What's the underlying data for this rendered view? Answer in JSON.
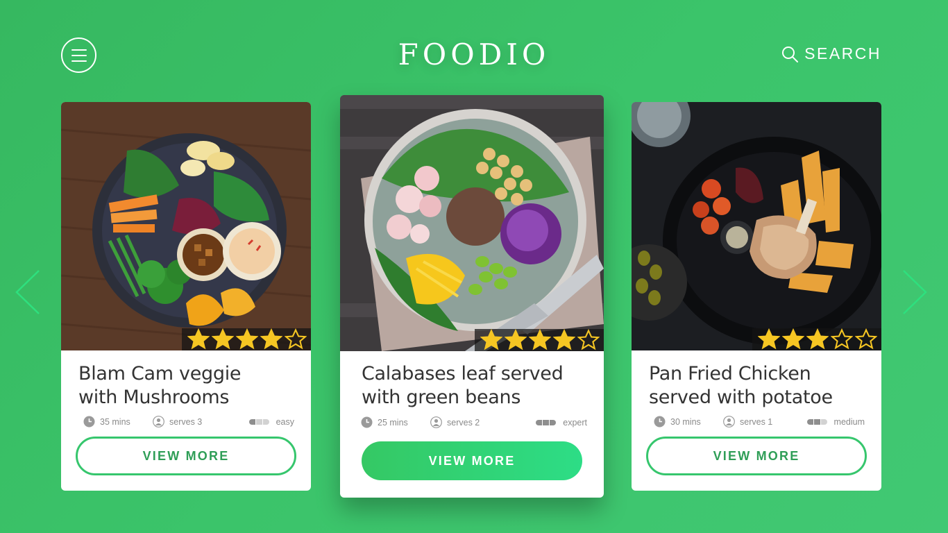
{
  "app": {
    "brand": "FOODIO",
    "search_label": "SEARCH"
  },
  "colors": {
    "background": "#3bc46a",
    "accent": "#36c66d",
    "star": "#f6c623"
  },
  "icons": {
    "menu": "hamburger-menu-icon",
    "search": "search-icon",
    "prev": "chevron-left-icon",
    "next": "chevron-right-icon",
    "time": "clock-icon",
    "serves": "person-icon"
  },
  "cards": [
    {
      "image": "vegetable-plate-with-dips",
      "title_line1": "Blam Cam veggie",
      "title_line2": "with Mushrooms",
      "rating": 4,
      "rating_max": 5,
      "time": "35 mins",
      "serves": "serves 3",
      "difficulty": "easy",
      "difficulty_level": 1,
      "cta": "VIEW MORE"
    },
    {
      "image": "buddha-bowl-salad",
      "title_line1": "Calabases leaf served",
      "title_line2": "with green beans",
      "rating": 4,
      "rating_max": 5,
      "time": "25 mins",
      "serves": "serves 2",
      "difficulty": "expert",
      "difficulty_level": 3,
      "cta": "VIEW MORE"
    },
    {
      "image": "pork-chop-with-potatoes",
      "title_line1": "Pan Fried Chicken",
      "title_line2": "served with potatoe",
      "rating": 3,
      "rating_max": 5,
      "time": "30 mins",
      "serves": "serves 1",
      "difficulty": "medium",
      "difficulty_level": 2,
      "cta": "VIEW MORE"
    }
  ]
}
